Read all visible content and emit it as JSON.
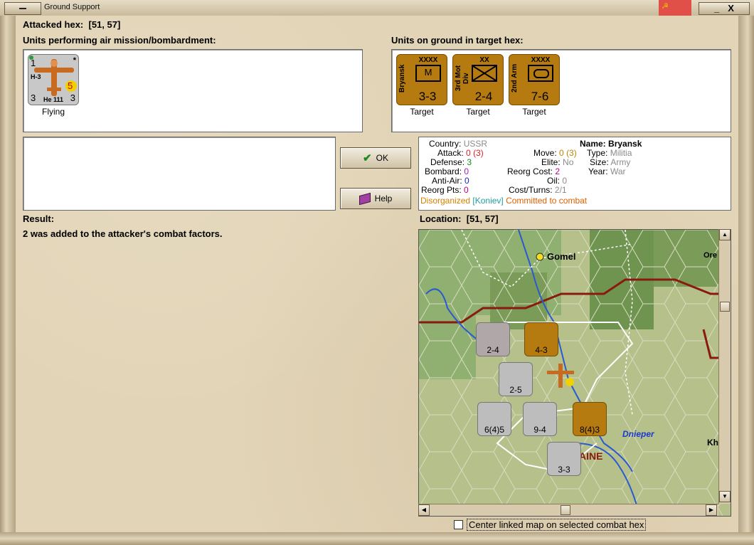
{
  "window": {
    "title": "Ground Support",
    "close_glyph": "X"
  },
  "header": {
    "attacked_hex_label": "Attacked hex:",
    "attacked_hex_value": "[51, 57]"
  },
  "air_units_panel": {
    "label": "Units performing air mission/bombardment:",
    "units": [
      {
        "name": "He 111",
        "type_code": "H-3",
        "top_left": "1",
        "bottom_left": "3",
        "bottom_right": "3",
        "marker": "*",
        "range": "5",
        "status": "Flying"
      }
    ]
  },
  "ground_units_panel": {
    "label": "Units on ground in target hex:",
    "units": [
      {
        "name": "Bryansk",
        "size": "XXXX",
        "symbol_letter": "M",
        "strength": "3-3",
        "status": "Target"
      },
      {
        "name": "3rd Mot Div",
        "size": "XX",
        "symbol_letter": "",
        "strength": "2-4",
        "status": "Target"
      },
      {
        "name": "2nd Arm",
        "size": "XXXX",
        "symbol_letter": "",
        "strength": "7-6",
        "status": "Target"
      }
    ]
  },
  "buttons": {
    "ok": "OK",
    "help": "Help"
  },
  "unit_info": {
    "country_label": "Country:",
    "country_value": "USSR",
    "attack_label": "Attack:",
    "attack_value": "0",
    "attack_extra": "(3)",
    "defense_label": "Defense:",
    "defense_value": "3",
    "bombard_label": "Bombard:",
    "bombard_value": "0",
    "antiair_label": "Anti-Air:",
    "antiair_value": "0",
    "reorg_pts_label": "Reorg Pts:",
    "reorg_pts_value": "0",
    "name_label": "Name:",
    "name_value": "Bryansk",
    "move_label": "Move:",
    "move_value": "0",
    "move_extra": "(3)",
    "elite_label": "Elite:",
    "elite_value": "No",
    "reorg_cost_label": "Reorg Cost:",
    "reorg_cost_value": "2",
    "oil_label": "Oil:",
    "oil_value": "0",
    "cost_turns_label": "Cost/Turns:",
    "cost_turns_value": "2/1",
    "type_label": "Type:",
    "type_value": "Militia",
    "size_label": "Size:",
    "size_value": "Army",
    "year_label": "Year:",
    "year_value": "War",
    "status_disorganized": "Disorganized",
    "status_leader": "[Koniev]",
    "status_committed": "Committed to combat",
    "colors": {
      "attack": "#e02020",
      "defense": "#1a8a1a",
      "bombard": "#a020c0",
      "antiair": "#2020d0",
      "reorg": "#c00080",
      "muted": "#8a8a8a",
      "orange": "#d88000",
      "teal": "#20a0a0",
      "orange_red": "#e06000"
    }
  },
  "result": {
    "label": "Result:",
    "text": "2 was added to the attacker's combat factors."
  },
  "location": {
    "label": "Location:",
    "value": "[51, 57]"
  },
  "map": {
    "labels": {
      "city": "Gomel",
      "city2": "Ore",
      "river": "Dnieper",
      "region": "AINE",
      "city3": "Kh"
    },
    "counters": [
      {
        "label": "2-4",
        "color": "grey"
      },
      {
        "label": "4-3",
        "color": "brown"
      },
      {
        "label": "2-5",
        "color": "grey"
      },
      {
        "label": "6(4)5",
        "color": "grey"
      },
      {
        "label": "9-4",
        "color": "grey"
      },
      {
        "label": "8(4)3",
        "color": "brown"
      },
      {
        "label": "3-3",
        "color": "grey"
      }
    ]
  },
  "footer": {
    "center_checkbox_label": "Center linked map on selected combat hex"
  }
}
